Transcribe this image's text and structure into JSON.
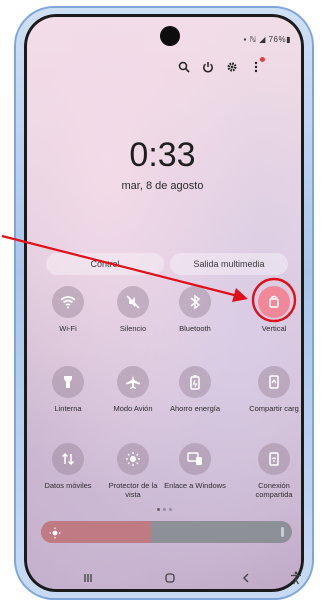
{
  "status_bar": {
    "text": "▪ ℕ ◢ 76%▮"
  },
  "top_icons": [
    "search-icon",
    "power-icon",
    "gear-icon",
    "more-options-icon"
  ],
  "clock": {
    "time": "0:33",
    "date": "mar, 8 de agosto"
  },
  "pills": {
    "control": "Control",
    "media": "Salida multimedia"
  },
  "tiles": [
    {
      "label": "Wi-Fi",
      "icon": "wifi-icon",
      "active": false
    },
    {
      "label": "Silencio",
      "icon": "mute-icon",
      "active": false
    },
    {
      "label": "Bluetooth",
      "icon": "bluetooth-icon",
      "active": false
    },
    {
      "label": "Vertical",
      "icon": "portrait-lock-icon",
      "active": true
    },
    {
      "label": "Linterna",
      "icon": "flashlight-icon",
      "active": false
    },
    {
      "label": "Modo Avión",
      "icon": "airplane-icon",
      "active": false
    },
    {
      "label": "Ahorro energía",
      "icon": "battery-saver-icon",
      "active": false
    },
    {
      "label": "Compartir carg",
      "icon": "share-charge-icon",
      "active": false
    },
    {
      "label": "Datos móviles",
      "icon": "mobile-data-icon",
      "active": false
    },
    {
      "label": "Protector de la vista",
      "icon": "eye-comfort-icon",
      "active": false
    },
    {
      "label": "Enlace a Windows",
      "icon": "link-windows-icon",
      "active": false
    },
    {
      "label": "Conexión compartida",
      "icon": "hotspot-icon",
      "active": false
    }
  ],
  "brightness": {
    "level": 0.44
  },
  "nav": [
    "recent-apps-icon",
    "home-icon",
    "back-icon",
    "accessibility-icon"
  ],
  "colors": {
    "accent_active": "#f0889a",
    "annotation": "#e0101a",
    "brightness_fill": "#c07a83"
  }
}
